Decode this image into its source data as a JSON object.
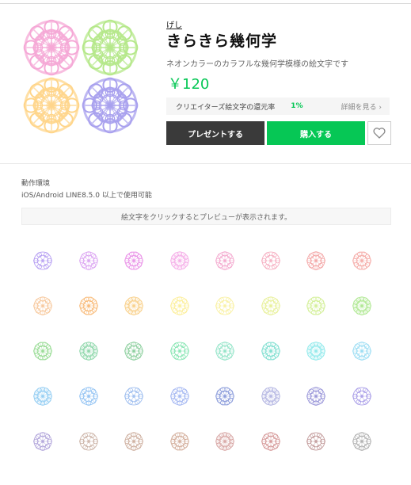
{
  "header": {
    "author": "げし",
    "title": "きらきら幾何学",
    "description": "ネオンカラーのカラフルな幾何学模様の絵文字です",
    "price": "￥120"
  },
  "creator_rate": {
    "label": "クリエイターズ絵文字の還元率",
    "percent": "1%",
    "more_label": "詳細を見る ›"
  },
  "actions": {
    "present_label": "プレゼントする",
    "buy_label": "購入する",
    "favorite_icon": "heart-outline-icon"
  },
  "environment": {
    "heading": "動作環境",
    "text": "iOS/Android LINE8.5.0 以上で使用可能"
  },
  "preview_hint": "絵文字をクリックするとプレビューが表示されます。",
  "hero_colors": [
    "#f5a8d6",
    "#b5e88a",
    "#ffd58a",
    "#a8a0ee"
  ],
  "emoji_rows": [
    [
      "#a98ef0",
      "#d79af0",
      "#e88ae6",
      "#f4a8e6",
      "#f29ec8",
      "#f4a0b6",
      "#f29a9a",
      "#f4a4a0"
    ],
    [
      "#f6c08e",
      "#f8b46c",
      "#f8cc80",
      "#fcec8a",
      "#f8ee90",
      "#e4ee8a",
      "#cfee8e",
      "#a8e688"
    ],
    [
      "#8ed88a",
      "#86d4a4",
      "#7cc890",
      "#70e0a4",
      "#84e0c0",
      "#74dccc",
      "#88e8ea",
      "#8cd8f2"
    ],
    [
      "#8ccaf2",
      "#86bcf2",
      "#8cb2ec",
      "#98aef0",
      "#8294d8",
      "#aeb0e0",
      "#8c88d4",
      "#9a8ce4"
    ],
    [
      "#a89ad6",
      "#c4a89a",
      "#c8a694",
      "#d0a894",
      "#d6a2a0",
      "#d08c8c",
      "#b88a8a",
      "#a8a8a8"
    ]
  ]
}
